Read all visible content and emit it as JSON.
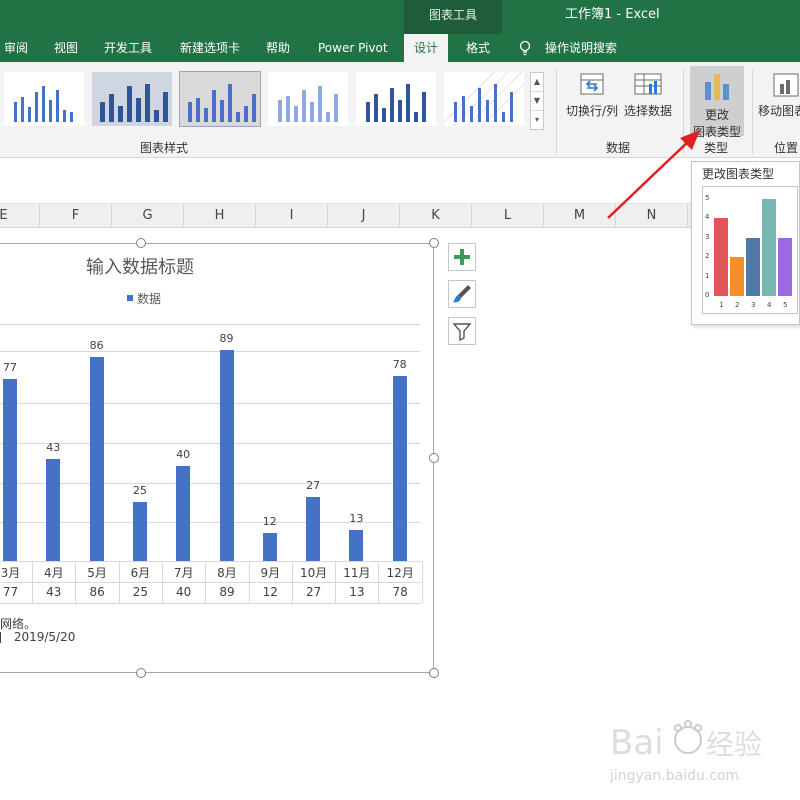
{
  "window": {
    "title": "工作簿1  -  Excel",
    "context_tab": "图表工具"
  },
  "tabs": [
    "审阅",
    "视图",
    "开发工具",
    "新建选项卡",
    "帮助",
    "Power Pivot",
    "设计",
    "格式"
  ],
  "search_label": "操作说明搜索",
  "ribbon": {
    "styles_group": "图表样式",
    "data_group": "数据",
    "type_group": "类型",
    "position_group": "位置",
    "switch_row_col": "切换行/列",
    "select_data": "选择数据",
    "change_type_line1": "更改",
    "change_type_line2": "图表类型",
    "move_chart": "移动图表"
  },
  "columns": [
    "E",
    "F",
    "G",
    "H",
    "I",
    "J",
    "K",
    "L",
    "M",
    "N"
  ],
  "chart": {
    "title": "输入数据标题",
    "legend": "数据",
    "bar_color": "#4472c4",
    "note_text": "网络。",
    "date_text": "2019/5/20"
  },
  "chart_data": {
    "type": "bar",
    "categories": [
      "3月",
      "4月",
      "5月",
      "6月",
      "7月",
      "8月",
      "9月",
      "10月",
      "11月",
      "12月"
    ],
    "values": [
      77,
      43,
      86,
      25,
      40,
      89,
      12,
      27,
      13,
      78
    ],
    "title": "输入数据标题",
    "series": [
      {
        "name": "数据",
        "values": [
          77,
          43,
          86,
          25,
          40,
          89,
          12,
          27,
          13,
          78
        ]
      }
    ]
  },
  "tooltip": {
    "title": "更改图表类型",
    "preview_values": [
      4,
      2,
      3,
      5,
      3
    ],
    "preview_categories": [
      "1",
      "2",
      "3",
      "4",
      "5"
    ],
    "preview_ticks": [
      "5",
      "4",
      "3",
      "2",
      "1",
      "0"
    ],
    "preview_colors": [
      "#e15759",
      "#f28e2b",
      "#4e79a7",
      "#76b7b2",
      "#9c6ade"
    ]
  },
  "watermark": {
    "brand": "Bai",
    "brand_cn": "经验",
    "url": "jingyan.baidu.com"
  },
  "colors": {
    "excel_green": "#217346",
    "arrow_red": "#e02020"
  }
}
